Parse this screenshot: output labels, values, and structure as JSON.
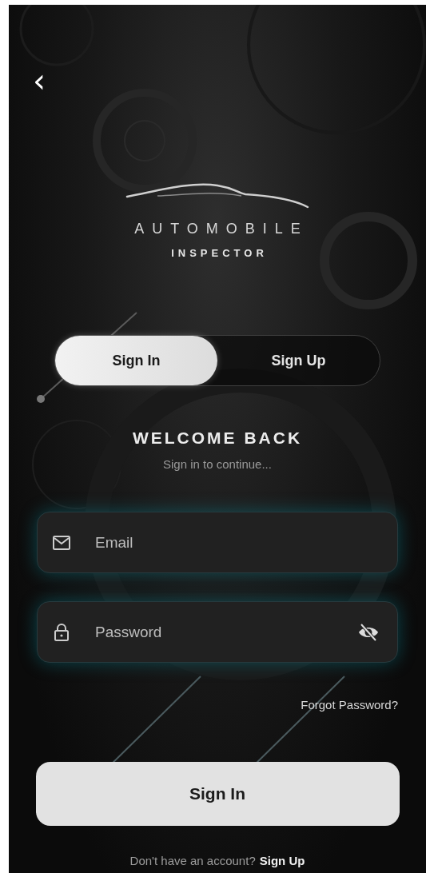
{
  "back_button": {
    "label": "‹"
  },
  "logo": {
    "line_1": "AUTOMOBILE",
    "line_2": "INSPECTOR"
  },
  "tabs": [
    {
      "label": "Sign In",
      "selected": true
    },
    {
      "label": "Sign Up",
      "selected": false
    }
  ],
  "heading": "WELCOME BACK",
  "subheading": "Sign in to continue...",
  "fields": [
    {
      "kind": "email",
      "placeholder": "Email"
    },
    {
      "kind": "password",
      "placeholder": "Password",
      "visibility_toggle": true
    }
  ],
  "forgot_link": "Forgot Password?",
  "primary_button": "Sign In",
  "footer": {
    "text": "Don't have an account?",
    "link": "Sign Up"
  }
}
